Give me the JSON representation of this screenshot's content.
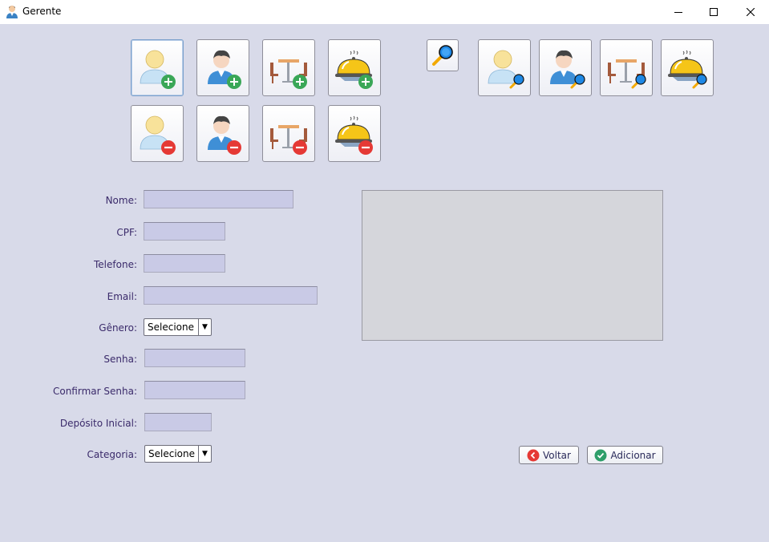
{
  "window": {
    "title": "Gerente",
    "controls": {
      "minimize": "minimize-icon",
      "maximize": "maximize-icon",
      "close": "close-icon"
    }
  },
  "toolbar": {
    "add_row": [
      {
        "icon": "client-add-icon"
      },
      {
        "icon": "employee-add-icon"
      },
      {
        "icon": "table-add-icon"
      },
      {
        "icon": "dish-add-icon"
      }
    ],
    "remove_row": [
      {
        "icon": "client-remove-icon"
      },
      {
        "icon": "employee-remove-icon"
      },
      {
        "icon": "table-remove-icon"
      },
      {
        "icon": "dish-remove-icon"
      }
    ],
    "search": {
      "icon": "search-icon"
    },
    "search_row": [
      {
        "icon": "client-search-icon"
      },
      {
        "icon": "employee-search-icon"
      },
      {
        "icon": "table-search-icon"
      },
      {
        "icon": "dish-search-icon"
      }
    ]
  },
  "form": {
    "nome": {
      "label": "Nome:",
      "value": ""
    },
    "cpf": {
      "label": "CPF:",
      "value": ""
    },
    "telefone": {
      "label": "Telefone:",
      "value": ""
    },
    "email": {
      "label": "Email:",
      "value": ""
    },
    "genero": {
      "label": "Gênero:",
      "selected": "Selecione"
    },
    "senha": {
      "label": "Senha:",
      "value": ""
    },
    "confirmar_senha": {
      "label": "Confirmar Senha:",
      "value": ""
    },
    "deposito_inicial": {
      "label": "Depósito Inicial:",
      "value": ""
    },
    "categoria": {
      "label": "Categoria:",
      "selected": "Selecione"
    }
  },
  "actions": {
    "voltar": "Voltar",
    "adicionar": "Adicionar"
  },
  "colors": {
    "background": "#d8dae9",
    "field": "#c9cae6",
    "add_badge": "#3aa757",
    "remove_badge": "#e53935",
    "search_badge": "#1e88e5",
    "dish_gold": "#f5c518"
  }
}
